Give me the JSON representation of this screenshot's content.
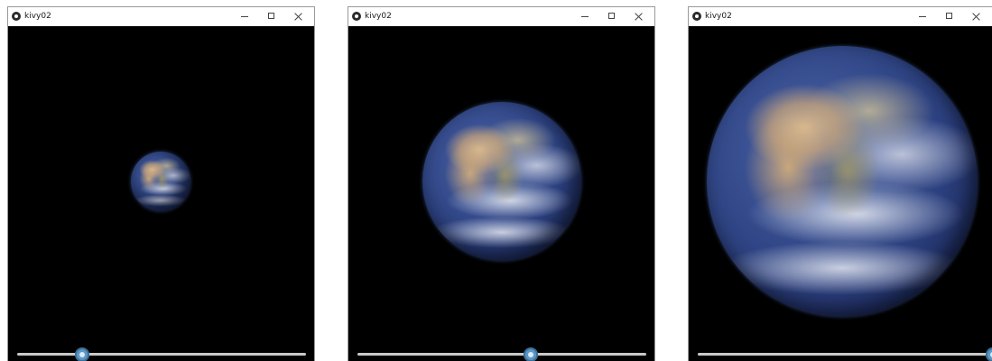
{
  "windows": [
    {
      "title": "kivy02",
      "icon": "kivy-logo-icon",
      "controls": [
        "minimize-icon",
        "maximize-icon",
        "close-icon"
      ],
      "content": "earth-image",
      "slider": {
        "value_fraction": 0.225
      }
    },
    {
      "title": "kivy02",
      "icon": "kivy-logo-icon",
      "controls": [
        "minimize-icon",
        "maximize-icon",
        "close-icon"
      ],
      "content": "earth-image",
      "slider": {
        "value_fraction": 0.6
      }
    },
    {
      "title": "kivy02",
      "icon": "kivy-logo-icon",
      "controls": [
        "minimize-icon",
        "maximize-icon",
        "close-icon"
      ],
      "content": "earth-image",
      "slider": {
        "value_fraction": 1.0
      }
    }
  ],
  "colors": {
    "canvas_background": "#000000",
    "titlebar_background": "#ffffff",
    "slider_track": "#c9c9c9",
    "slider_thumb": "#5d97c5"
  }
}
